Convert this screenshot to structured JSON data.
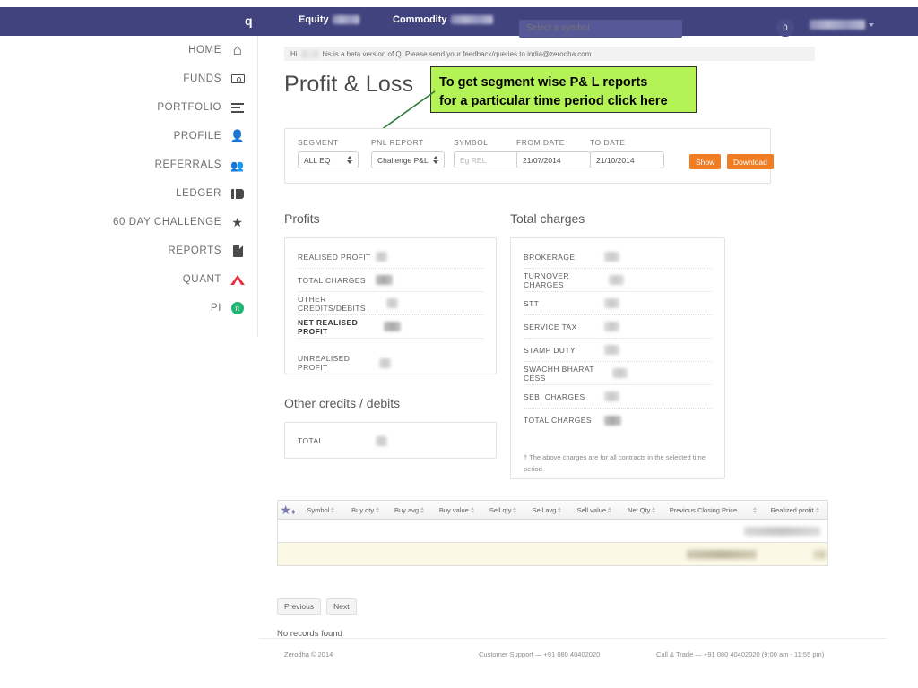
{
  "navbar": {
    "logo": "q",
    "equity_label": "Equity",
    "commodity_label": "Commodity",
    "search_placeholder": "Select a symbol",
    "badge_count": "0"
  },
  "sidebar": {
    "items": [
      {
        "label": "HOME",
        "icon": "home-icon"
      },
      {
        "label": "FUNDS",
        "icon": "funds-icon"
      },
      {
        "label": "PORTFOLIO",
        "icon": "portfolio-icon"
      },
      {
        "label": "PROFILE",
        "icon": "profile-icon"
      },
      {
        "label": "REFERRALS",
        "icon": "referrals-icon"
      },
      {
        "label": "LEDGER",
        "icon": "ledger-icon"
      },
      {
        "label": "60 DAY CHALLENGE",
        "icon": "star-icon"
      },
      {
        "label": "REPORTS",
        "icon": "reports-icon"
      },
      {
        "label": "QUANT",
        "icon": "quant-icon"
      },
      {
        "label": "PI",
        "icon": "pi-icon"
      }
    ]
  },
  "notice": {
    "greeting": "Hi",
    "text": "his is a beta version of Q. Please send your feedback/queries to india@zerodha.com"
  },
  "page": {
    "title": "Profit & Loss"
  },
  "callout": {
    "line1": "To get segment wise P& L reports",
    "line2": "for a particular time period click here",
    "bg_color": "#b3f355",
    "arrow_color": "#2d7a35"
  },
  "filters": {
    "segment": {
      "label": "SEGMENT",
      "value": "ALL EQ"
    },
    "pnl_report": {
      "label": "PNL REPORT",
      "value": "Challenge P&L"
    },
    "symbol": {
      "label": "SYMBOL",
      "value": "",
      "placeholder": "Eg REL"
    },
    "from_date": {
      "label": "FROM DATE",
      "value": "21/07/2014"
    },
    "to_date": {
      "label": "TO DATE",
      "value": "21/10/2014"
    },
    "show_button": "Show",
    "download_button": "Download"
  },
  "profits": {
    "heading": "Profits",
    "rows": [
      {
        "label": "REALISED PROFIT"
      },
      {
        "label": "TOTAL CHARGES"
      },
      {
        "label": "OTHER CREDITS/DEBITS"
      },
      {
        "label": "NET REALISED PROFIT"
      },
      {
        "label": "UNREALISED PROFIT"
      }
    ]
  },
  "other_credits": {
    "heading": "Other credits / debits",
    "rows": [
      {
        "label": "TOTAL"
      }
    ]
  },
  "charges": {
    "heading": "Total charges",
    "rows": [
      {
        "label": "BROKERAGE"
      },
      {
        "label": "TURNOVER CHARGES"
      },
      {
        "label": "STT"
      },
      {
        "label": "SERVICE TAX"
      },
      {
        "label": "STAMP DUTY"
      },
      {
        "label": "SWACHH BHARAT CESS"
      },
      {
        "label": "SEBI CHARGES"
      },
      {
        "label": "TOTAL CHARGES"
      }
    ],
    "footnote": "† The above charges are for all contracts in the selected time period."
  },
  "table": {
    "columns": [
      "Symbol",
      "Buy qty",
      "Buy avg",
      "Buy value",
      "Sell qty",
      "Sell avg",
      "Sell value",
      "Net Qty",
      "Previous Closing Price",
      "Realized profit"
    ],
    "previous_button": "Previous",
    "next_button": "Next",
    "empty_message": "No records found"
  },
  "footer": {
    "copyright": "Zerodha © 2014",
    "customer_support": "Customer Support — +91 080 40402020",
    "call_trade": "Call & Trade — +91 080 40402020 (9:00 am - 11:55 pm)"
  }
}
